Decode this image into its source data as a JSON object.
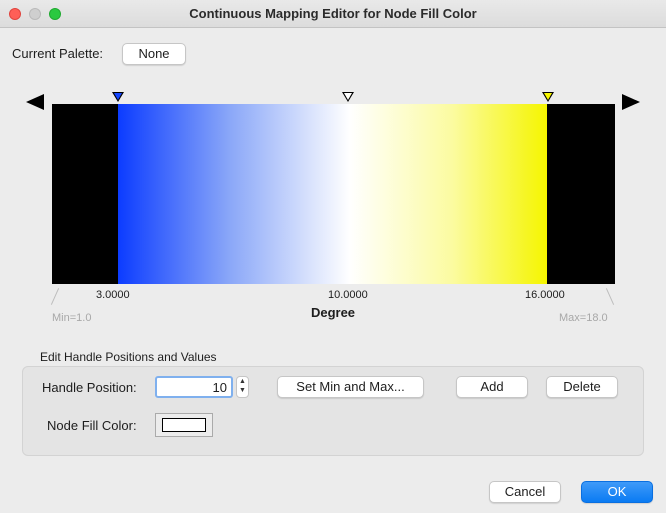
{
  "window": {
    "title": "Continuous Mapping Editor for Node Fill Color"
  },
  "palette": {
    "label": "Current Palette:",
    "button": "None"
  },
  "editor": {
    "colors": {
      "min_side": "#000000",
      "low": "#0c3cff",
      "mid": "#ffffff",
      "high": "#f5f500",
      "max_side": "#000000"
    },
    "handles": [
      {
        "value": "3.0000",
        "color": "#1446ff"
      },
      {
        "value": "10.0000",
        "color": "#ffffff"
      },
      {
        "value": "16.0000",
        "color": "#f7f700"
      }
    ],
    "min_label": "Min=1.0",
    "max_label": "Max=18.0",
    "attribute": "Degree"
  },
  "handle_panel": {
    "title": "Edit Handle Positions and Values",
    "position_label": "Handle Position:",
    "position_value": "10",
    "set_minmax_button": "Set Min and Max...",
    "add_button": "Add",
    "delete_button": "Delete",
    "color_label": "Node Fill Color:",
    "color_value": "#ffffff"
  },
  "footer": {
    "cancel": "Cancel",
    "ok": "OK"
  }
}
